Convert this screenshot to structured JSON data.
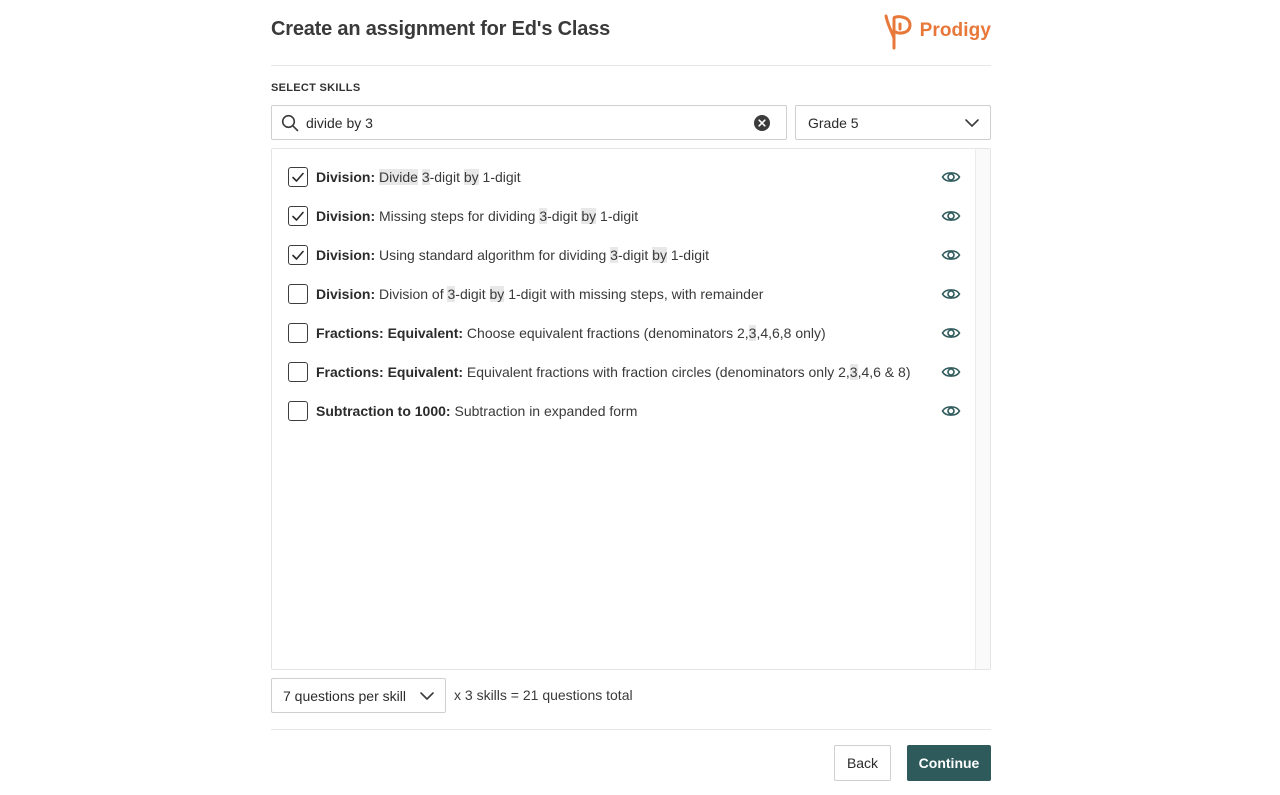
{
  "header": {
    "title": "Create an assignment for Ed's Class",
    "logo_text": "Prodigy",
    "logo_icon": "prodigy-p-icon",
    "brand_color": "#e8773a"
  },
  "skills_section": {
    "label": "SELECT SKILLS",
    "search": {
      "value": "divide by 3",
      "icon": "search-icon"
    },
    "grade": {
      "selected": "Grade 5"
    }
  },
  "skills": [
    {
      "checked": true,
      "category": "Division:",
      "parts": [
        [
          "Divide",
          true
        ],
        [
          " ",
          false
        ],
        [
          "3",
          true
        ],
        [
          "-digit ",
          false
        ],
        [
          "by",
          true
        ],
        [
          " 1-digit",
          false
        ]
      ]
    },
    {
      "checked": true,
      "category": "Division:",
      "parts": [
        [
          "Missing steps for dividing ",
          false
        ],
        [
          "3",
          true
        ],
        [
          "-digit ",
          false
        ],
        [
          "by",
          true
        ],
        [
          " 1-digit",
          false
        ]
      ]
    },
    {
      "checked": true,
      "category": "Division:",
      "parts": [
        [
          "Using standard algorithm for dividing ",
          false
        ],
        [
          "3",
          true
        ],
        [
          "-digit ",
          false
        ],
        [
          "by",
          true
        ],
        [
          " 1-digit",
          false
        ]
      ]
    },
    {
      "checked": false,
      "category": "Division:",
      "parts": [
        [
          "Division of ",
          false
        ],
        [
          "3",
          true
        ],
        [
          "-digit ",
          false
        ],
        [
          "by",
          true
        ],
        [
          " 1-digit with missing steps, with remainder",
          false
        ]
      ]
    },
    {
      "checked": false,
      "category": "Fractions: Equivalent:",
      "parts": [
        [
          "Choose equivalent fractions (denominators 2,",
          false
        ],
        [
          "3",
          true
        ],
        [
          ",4,6,8 only)",
          false
        ]
      ]
    },
    {
      "checked": false,
      "category": "Fractions: Equivalent:",
      "parts": [
        [
          "Equivalent fractions with fraction circles (denominators only 2,",
          false
        ],
        [
          "3",
          true
        ],
        [
          ",4,6 & 8)",
          false
        ]
      ]
    },
    {
      "checked": false,
      "category": "Subtraction to 1000:",
      "parts": [
        [
          "Subtraction in expanded form",
          false
        ]
      ]
    }
  ],
  "footer": {
    "questions_per_skill": "7 questions per skill",
    "total_text": "x 3 skills = 21 questions total",
    "back_label": "Back",
    "continue_label": "Continue",
    "continue_color": "#2f5a5b"
  }
}
